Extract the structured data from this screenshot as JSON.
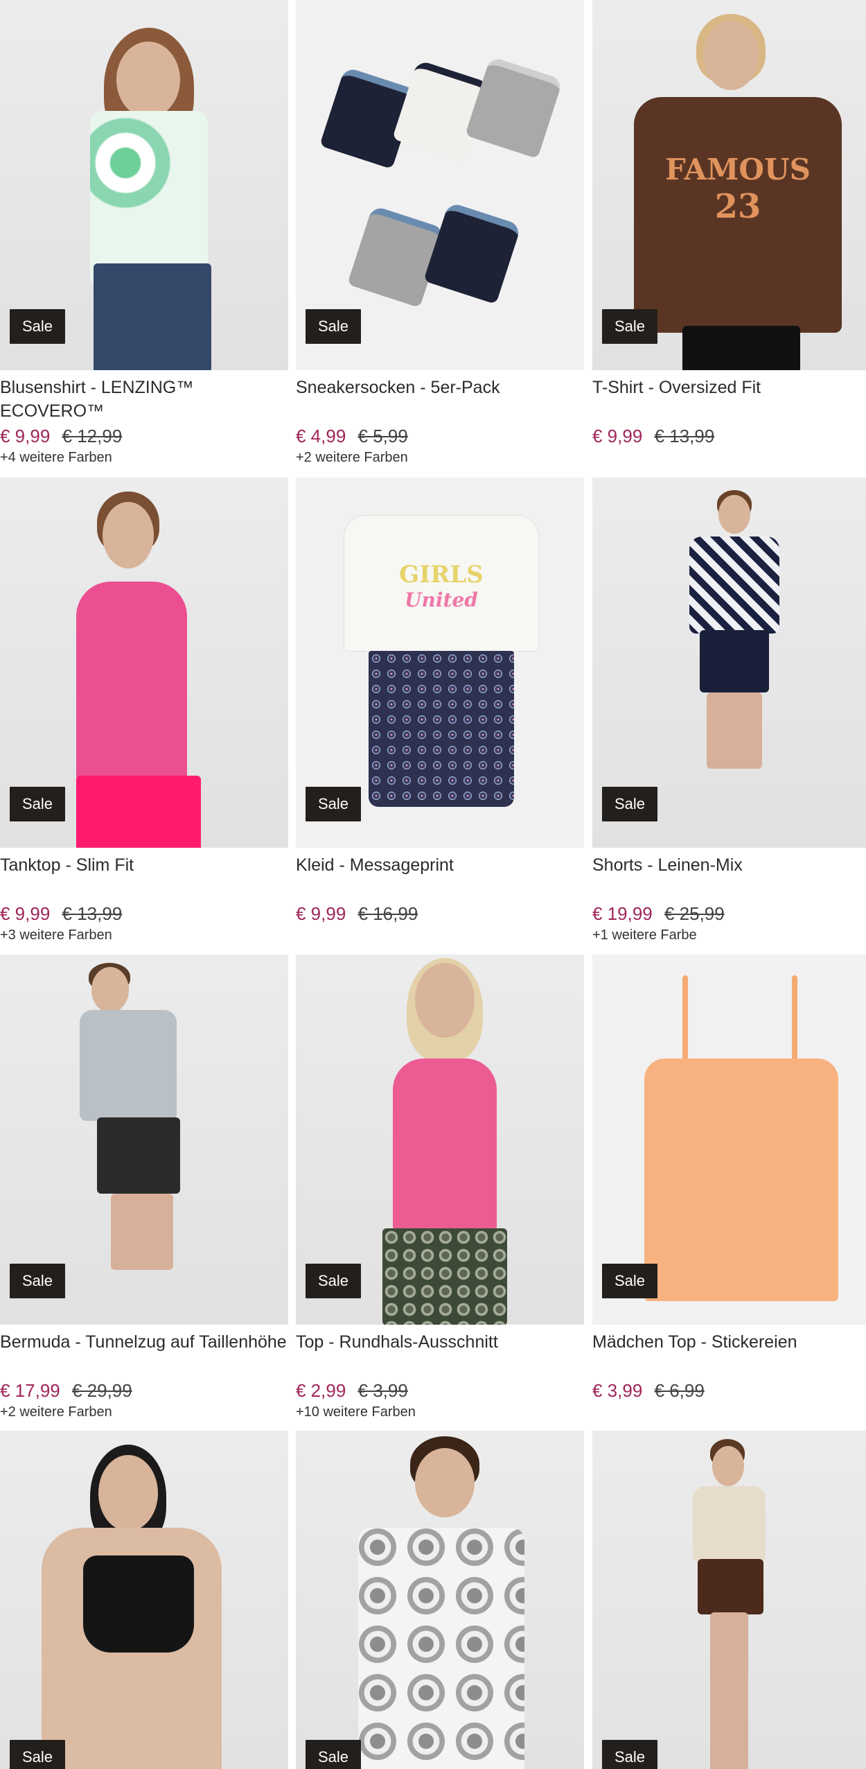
{
  "sale_label": "Sale",
  "products": [
    {
      "title": "Blusenshirt - LENZING™ ECOVERO™",
      "price": "€ 9,99",
      "old_price": "€ 12,99",
      "colors": "+4 weitere Farben",
      "image": "woman-floral-blouse"
    },
    {
      "title": "Sneakersocken - 5er-Pack",
      "price": "€ 4,99",
      "old_price": "€ 5,99",
      "colors": "+2 weitere Farben",
      "image": "sneaker-socks-5-pack"
    },
    {
      "title": "T-Shirt - Oversized Fit",
      "price": "€ 9,99",
      "old_price": "€ 13,99",
      "colors": "",
      "image": "woman-brown-famous-tshirt"
    },
    {
      "title": "Tanktop - Slim Fit",
      "price": "€ 9,99",
      "old_price": "€ 13,99",
      "colors": "+3 weitere Farben",
      "image": "woman-pink-tanktop"
    },
    {
      "title": "Kleid - Messageprint",
      "price": "€ 9,99",
      "old_price": "€ 16,99",
      "colors": "",
      "image": "girls-dress"
    },
    {
      "title": "Shorts - Leinen-Mix",
      "price": "€ 19,99",
      "old_price": "€ 25,99",
      "colors": "+1 weitere Farbe",
      "image": "man-navy-shorts"
    },
    {
      "title": "Bermuda - Tunnelzug auf Taillenhöhe",
      "price": "€ 17,99",
      "old_price": "€ 29,99",
      "colors": "+2 weitere Farben",
      "image": "man-grey-bermuda"
    },
    {
      "title": "Top - Rundhals-Ausschnitt",
      "price": "€ 2,99",
      "old_price": "€ 3,99",
      "colors": "+10 weitere Farben",
      "image": "woman-pink-top"
    },
    {
      "title": "Mädchen Top - Stickereien",
      "price": "€ 3,99",
      "old_price": "€ 6,99",
      "colors": "",
      "image": "girls-peach-top"
    },
    {
      "title": "",
      "price": "",
      "old_price": "",
      "colors": "",
      "image": "woman-black-bikini"
    },
    {
      "title": "",
      "price": "",
      "old_price": "",
      "colors": "",
      "image": "man-tiedye-tshirt"
    },
    {
      "title": "",
      "price": "",
      "old_price": "",
      "colors": "",
      "image": "woman-beige-shirt-brown-shorts"
    }
  ],
  "prints": {
    "famous_line1": "FAMOUS",
    "famous_line2": "23",
    "girls_line1": "GIRLS",
    "girls_line2": "United"
  },
  "colors": {
    "sale_badge": "#231f1c",
    "sale_price": "#a0255a"
  }
}
